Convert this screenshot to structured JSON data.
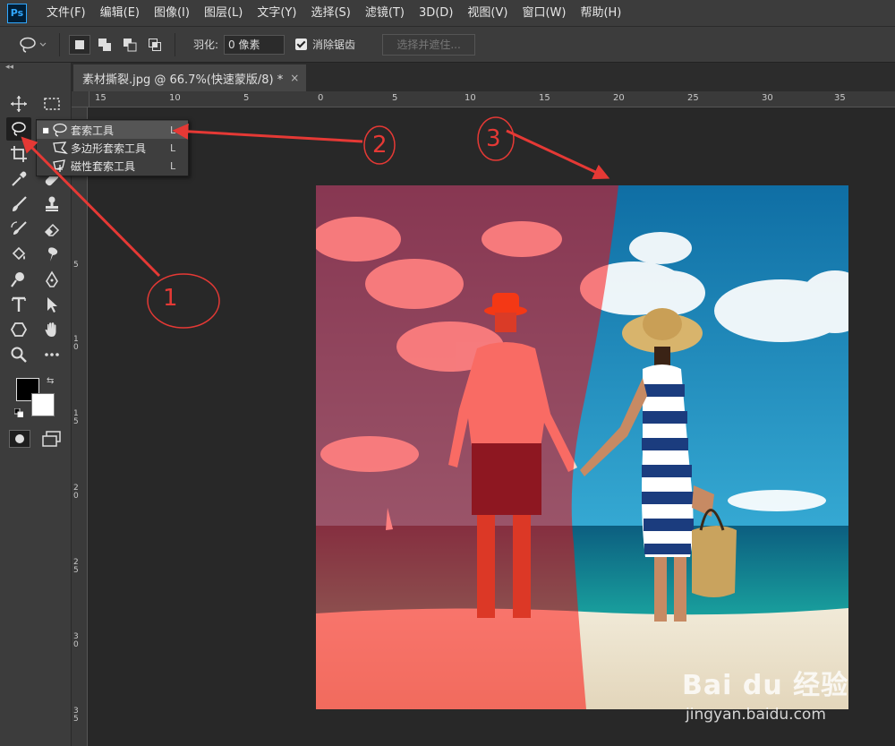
{
  "app": {
    "logo_text": "Ps"
  },
  "menu": [
    "文件(F)",
    "编辑(E)",
    "图像(I)",
    "图层(L)",
    "文字(Y)",
    "选择(S)",
    "滤镜(T)",
    "3D(D)",
    "视图(V)",
    "窗口(W)",
    "帮助(H)"
  ],
  "options": {
    "feather_label": "羽化:",
    "feather_value": "0 像素",
    "antialias_label": "消除锯齿",
    "antialias_checked": true,
    "select_mask_label": "选择并遮住..."
  },
  "document_tab": {
    "title": "素材撕裂.jpg @ 66.7%(快速蒙版/8) *",
    "close": "×"
  },
  "ruler_h": [
    "15",
    "10",
    "5",
    "0",
    "5",
    "10",
    "15",
    "20",
    "25",
    "30",
    "35"
  ],
  "ruler_v": [
    "5",
    "1 0",
    "1 5",
    "2 0",
    "2 5",
    "3 0",
    "3 5"
  ],
  "flyout": {
    "items": [
      {
        "label": "套索工具",
        "key": "L",
        "icon": "lasso-icon",
        "selected": true
      },
      {
        "label": "多边形套索工具",
        "key": "L",
        "icon": "polygonal-lasso-icon",
        "selected": false
      },
      {
        "label": "磁性套索工具",
        "key": "L",
        "icon": "magnetic-lasso-icon",
        "selected": false
      }
    ]
  },
  "annotations": [
    "1",
    "2",
    "3"
  ],
  "watermark": {
    "logo": "Bai du 经验",
    "url": "jingyan.baidu.com"
  },
  "colors": {
    "accent_red": "#e53935",
    "quickmask_overlay": "rgba(255,0,0,0.5)",
    "foreground": "#000000",
    "background": "#ffffff"
  }
}
